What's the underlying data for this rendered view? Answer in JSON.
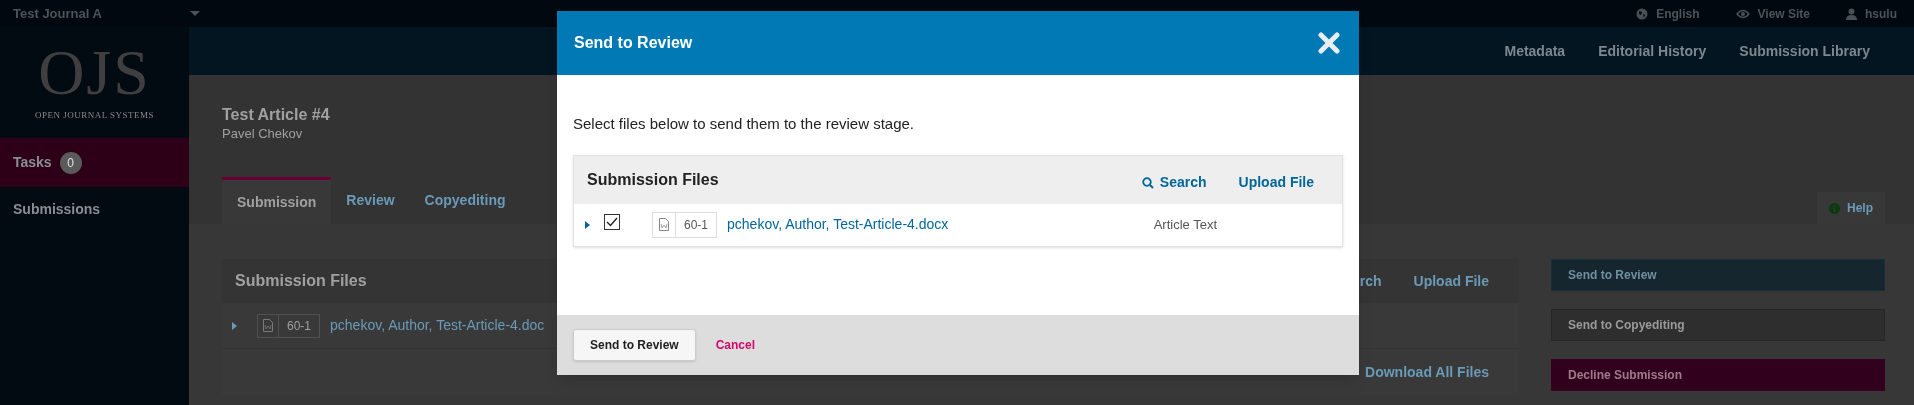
{
  "top_bar": {
    "journal": "Test Journal A",
    "links": [
      {
        "kind": "globe",
        "label": "English"
      },
      {
        "kind": "eye",
        "label": "View Site"
      },
      {
        "kind": "user",
        "label": "hsulu"
      }
    ]
  },
  "sidebar": {
    "logo": {
      "letters": "OJS",
      "tagline": "OPEN JOURNAL SYSTEMS"
    },
    "items": [
      {
        "label": "Tasks",
        "badge": "0",
        "selected": true
      },
      {
        "label": "Submissions",
        "selected": false
      }
    ]
  },
  "header_nav": [
    "Metadata",
    "Editorial History",
    "Submission Library"
  ],
  "article": {
    "title": "Test Article #4",
    "author": "Pavel Chekov"
  },
  "tabs": [
    {
      "label": "Submission",
      "selected": true
    },
    {
      "label": "Review",
      "selected": false
    },
    {
      "label": "Copyediting",
      "selected": false
    }
  ],
  "help": "Help",
  "background_files": {
    "title": "Submission Files",
    "file": {
      "id": "60-1",
      "name": "pchekov, Author, Test-Article-4.doc"
    },
    "actions": [
      "rch",
      "Upload File"
    ],
    "footer_action": "Download All Files"
  },
  "decision_buttons": [
    {
      "label": "Send to Review",
      "kind": "primary"
    },
    {
      "label": "Send to Copyediting",
      "kind": "default"
    },
    {
      "label": "Decline Submission",
      "kind": "danger"
    }
  ],
  "modal": {
    "title": "Send to Review",
    "instructions": "Select files below to send them to the review stage.",
    "files": {
      "title": "Submission Files",
      "actions": [
        {
          "label": "Search",
          "kind": "search"
        },
        {
          "label": "Upload File",
          "kind": "link"
        }
      ],
      "rows": [
        {
          "checked": true,
          "id": "60-1",
          "name": "pchekov, Author, Test-Article-4.docx",
          "type": "Article Text"
        }
      ]
    },
    "buttons": [
      {
        "label": "Send to Review",
        "kind": "default"
      },
      {
        "label": "Cancel",
        "kind": "cancel"
      }
    ]
  }
}
